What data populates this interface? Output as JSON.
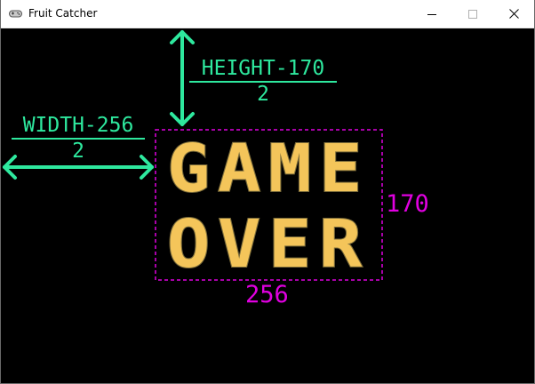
{
  "window": {
    "title": "Fruit Catcher",
    "controls": {
      "minimize": "minimize",
      "maximize": "maximize",
      "close": "close"
    }
  },
  "annotations": {
    "height_offset": {
      "numerator": "HEIGHT-170",
      "denominator": "2"
    },
    "width_offset": {
      "numerator": "WIDTH-256",
      "denominator": "2"
    },
    "sprite_height": "170",
    "sprite_width": "256"
  },
  "sprite": {
    "line1": "GAME",
    "line2": "OVER"
  },
  "colors": {
    "arrow": "#2ee89e",
    "dimension": "#e000e0",
    "sprite_fill": "#f4c55a",
    "background": "#000000"
  }
}
